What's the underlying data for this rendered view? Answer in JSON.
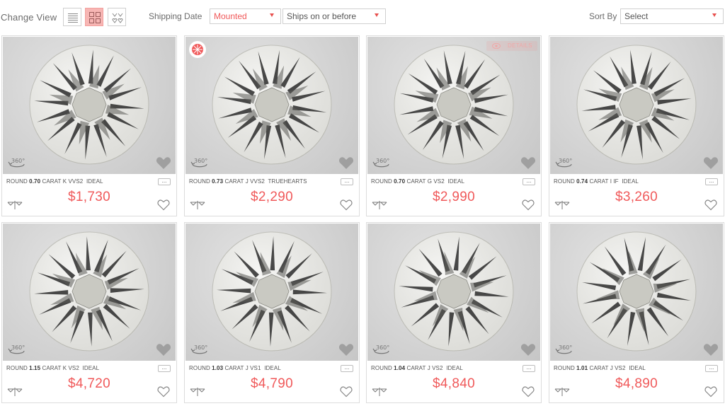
{
  "toolbar": {
    "change_view_label": "Change View",
    "view_modes": [
      "list-view-icon",
      "grid-view-icon",
      "hearts-view-icon"
    ],
    "active_view": "grid-view-icon",
    "shipping_date_label": "Shipping Date",
    "shipping_mode": "Mounted",
    "ships_on_before": "Ships on or before",
    "sort_by_label": "Sort By",
    "sort_value": "Select"
  },
  "colors": {
    "accent": "#f0595a",
    "active_bg": "#f7b6b4"
  },
  "cards": [
    {
      "shape": "ROUND",
      "carat": "0.70",
      "carat_label": "CARAT",
      "color": "K",
      "clarity": "VVS2",
      "cut": "IDEAL",
      "price": "$1,730",
      "badge": false,
      "details": false
    },
    {
      "shape": "ROUND",
      "carat": "0.73",
      "carat_label": "CARAT",
      "color": "J",
      "clarity": "VVS2",
      "cut": "TRUEHEARTS",
      "price": "$2,290",
      "badge": true,
      "details": false
    },
    {
      "shape": "ROUND",
      "carat": "0.70",
      "carat_label": "CARAT",
      "color": "G",
      "clarity": "VS2",
      "cut": "IDEAL",
      "price": "$2,990",
      "badge": false,
      "details": true
    },
    {
      "shape": "ROUND",
      "carat": "0.74",
      "carat_label": "CARAT",
      "color": "I",
      "clarity": "IF",
      "cut": "IDEAL",
      "price": "$3,260",
      "badge": false,
      "details": false
    },
    {
      "shape": "ROUND",
      "carat": "1.15",
      "carat_label": "CARAT",
      "color": "K",
      "clarity": "VS2",
      "cut": "IDEAL",
      "price": "$4,720",
      "badge": false,
      "details": false
    },
    {
      "shape": "ROUND",
      "carat": "1.03",
      "carat_label": "CARAT",
      "color": "J",
      "clarity": "VS1",
      "cut": "IDEAL",
      "price": "$4,790",
      "badge": false,
      "details": false
    },
    {
      "shape": "ROUND",
      "carat": "1.04",
      "carat_label": "CARAT",
      "color": "J",
      "clarity": "VS2",
      "cut": "IDEAL",
      "price": "$4,840",
      "badge": false,
      "details": false
    },
    {
      "shape": "ROUND",
      "carat": "1.01",
      "carat_label": "CARAT",
      "color": "J",
      "clarity": "VS2",
      "cut": "IDEAL",
      "price": "$4,890",
      "badge": false,
      "details": false
    }
  ],
  "details_label": "DETAILS",
  "more_label": "..."
}
